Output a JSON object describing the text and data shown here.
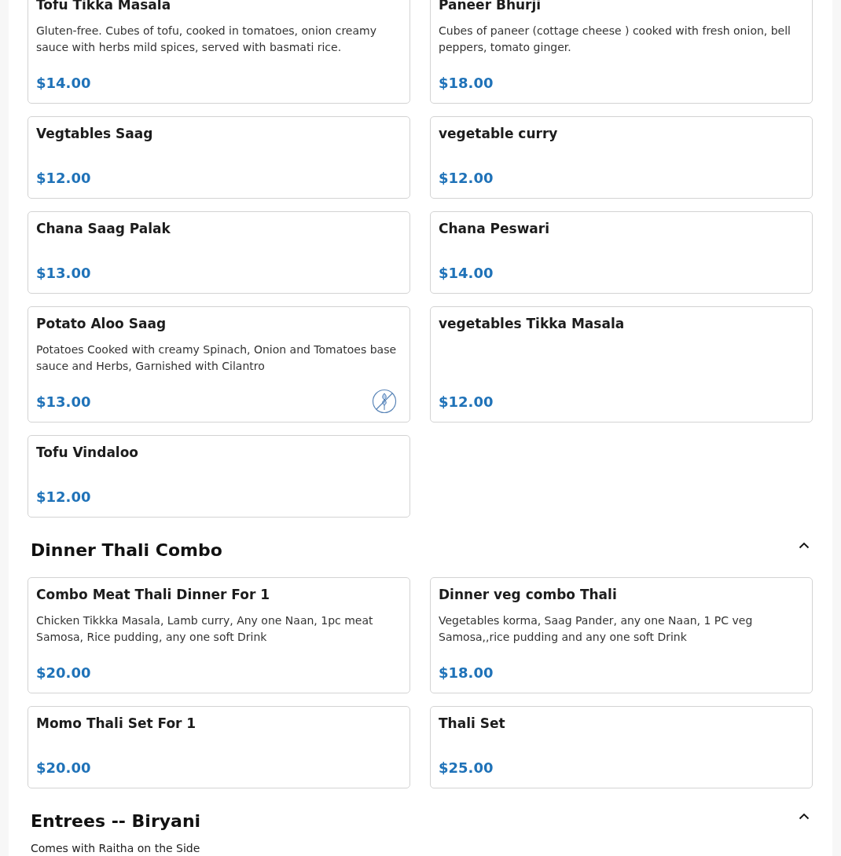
{
  "sections": [
    {
      "items": [
        {
          "name": "Tofu Tikka Masala",
          "description": "Gluten-free. Cubes of tofu, cooked in tomatoes, onion creamy sauce with herbs mild spices, served with basmati rice.",
          "price": "$14.00",
          "no_wheat": false
        },
        {
          "name": "Paneer Bhurji",
          "description": "Cubes of paneer (cottage cheese ) cooked with fresh onion, bell peppers, tomato ginger.",
          "price": "$18.00",
          "no_wheat": false
        },
        {
          "name": "Vegtables Saag",
          "price": "$12.00",
          "no_wheat": false
        },
        {
          "name": "vegetable curry",
          "price": "$12.00",
          "no_wheat": false
        },
        {
          "name": "Chana Saag Palak",
          "price": "$13.00",
          "no_wheat": false
        },
        {
          "name": "Chana Peswari",
          "price": "$14.00",
          "no_wheat": false
        },
        {
          "name": "Potato Aloo Saag",
          "description": "Potatoes Cooked with creamy Spinach, Onion and Tomatoes base sauce and Herbs, Garnished with Cilantro",
          "price": "$13.00",
          "no_wheat": true
        },
        {
          "name": "vegetables Tikka Masala",
          "price": "$12.00",
          "no_wheat": false
        },
        {
          "name": "Tofu Vindaloo",
          "price": "$12.00",
          "no_wheat": false
        }
      ]
    },
    {
      "title": "Dinner Thali Combo",
      "expanded": true,
      "items": [
        {
          "name": "Combo Meat Thali Dinner For 1",
          "description": "Chicken Tikkka Masala, Lamb curry, Any one Naan, 1pc meat Samosa, Rice pudding, any one soft Drink",
          "price": "$20.00",
          "no_wheat": false
        },
        {
          "name": "Dinner veg combo Thali",
          "description": "Vegetables korma, Saag Pander, any one Naan, 1 PC veg Samosa,,rice pudding and any one soft Drink",
          "price": "$18.00",
          "no_wheat": false
        },
        {
          "name": "Momo Thali Set For 1",
          "price": "$20.00",
          "no_wheat": false
        },
        {
          "name": "Thali Set",
          "price": "$25.00",
          "no_wheat": false
        }
      ]
    },
    {
      "title": "Entrees -- Biryani",
      "expanded": true,
      "note": "Comes with Raitha on the Side"
    }
  ]
}
